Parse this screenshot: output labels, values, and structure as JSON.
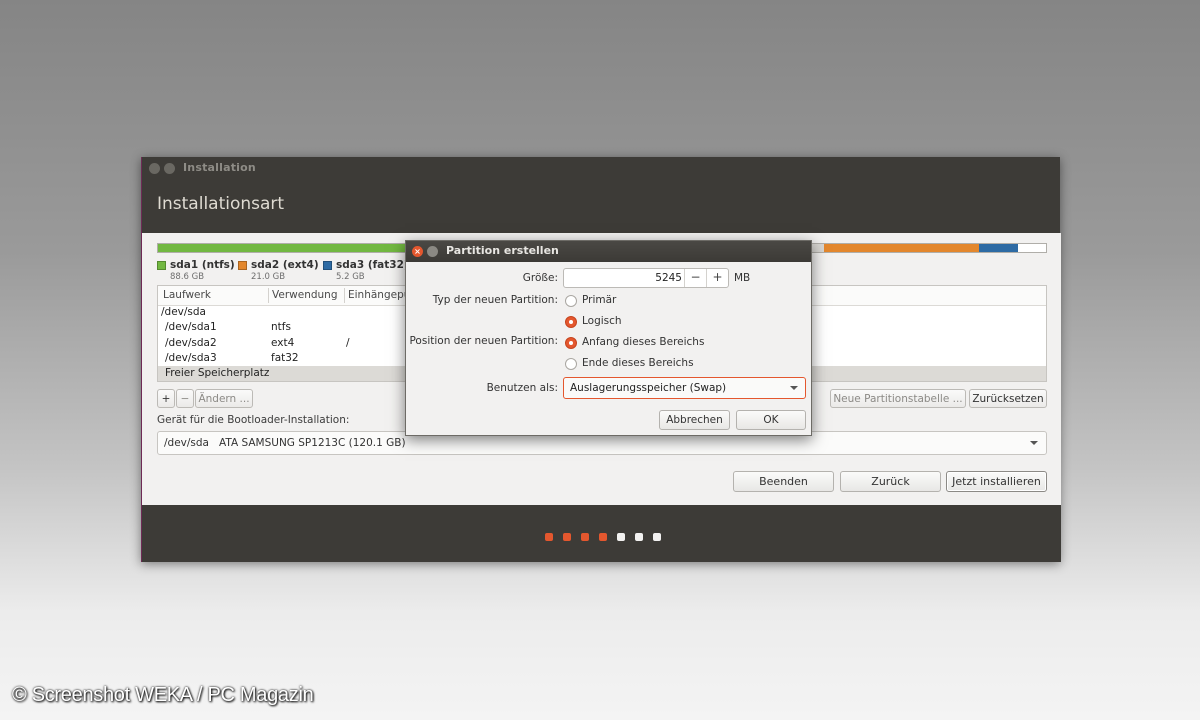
{
  "window": {
    "title": "Installation",
    "heading": "Installationsart"
  },
  "colors": {
    "accent": "#e4572e",
    "green": "#72b841",
    "orange": "#e3872d",
    "blue": "#2e6ba4"
  },
  "partition_bar": {
    "segments": [
      {
        "name": "sda1",
        "fraction": 0.29,
        "color": "#72b841"
      },
      {
        "name": "gap",
        "fraction": 0.46,
        "color": "#d8d6d2"
      },
      {
        "name": "sda2",
        "fraction": 0.175,
        "color": "#e3872d"
      },
      {
        "name": "sda3",
        "fraction": 0.043,
        "color": "#2e6ba4"
      },
      {
        "name": "free",
        "fraction": 0.032,
        "color": "#ffffff"
      }
    ]
  },
  "legend": [
    {
      "name": "sda1 (ntfs)",
      "size": "88.6 GB",
      "color": "#72b841"
    },
    {
      "name": "sda2 (ext4)",
      "size": "21.0 GB",
      "color": "#e3872d"
    },
    {
      "name": "sda3 (fat32)",
      "size": "5.2 GB",
      "color": "#2e6ba4"
    }
  ],
  "table": {
    "columns": [
      "Laufwerk",
      "Verwendung",
      "Einhängepu"
    ],
    "rows": [
      {
        "device": "/dev/sda",
        "use": "",
        "mount": ""
      },
      {
        "device": "/dev/sda1",
        "use": "ntfs",
        "mount": ""
      },
      {
        "device": "/dev/sda2",
        "use": "ext4",
        "mount": "/"
      },
      {
        "device": "/dev/sda3",
        "use": "fat32",
        "mount": ""
      },
      {
        "device": "Freier Speicherplatz",
        "use": "",
        "mount": ""
      }
    ]
  },
  "table_actions": {
    "add": "+",
    "remove": "−",
    "change": "Ändern ...",
    "new_table": "Neue Partitionstabelle ...",
    "reset": "Zurücksetzen"
  },
  "bootloader": {
    "label": "Gerät für die Bootloader-Installation:",
    "device": "/dev/sda",
    "model": "ATA SAMSUNG SP1213C (120.1 GB)"
  },
  "nav_buttons": {
    "quit": "Beenden",
    "back": "Zurück",
    "install": "Jetzt installieren"
  },
  "progress": {
    "total_steps": 7,
    "completed_steps": 4
  },
  "dialog": {
    "title": "Partition erstellen",
    "size_label": "Größe:",
    "size_value": "5245",
    "size_unit": "MB",
    "minus": "−",
    "plus": "+",
    "type_label": "Typ der neuen Partition:",
    "type_options": [
      {
        "label": "Primär",
        "selected": false
      },
      {
        "label": "Logisch",
        "selected": true
      }
    ],
    "position_label": "Position der neuen Partition:",
    "position_options": [
      {
        "label": "Anfang dieses Bereichs",
        "selected": true
      },
      {
        "label": "Ende dieses Bereichs",
        "selected": false
      }
    ],
    "use_label": "Benutzen als:",
    "use_value": "Auslagerungsspeicher (Swap)",
    "cancel": "Abbrechen",
    "ok": "OK"
  },
  "watermark": "© Screenshot WEKA / PC Magazin"
}
